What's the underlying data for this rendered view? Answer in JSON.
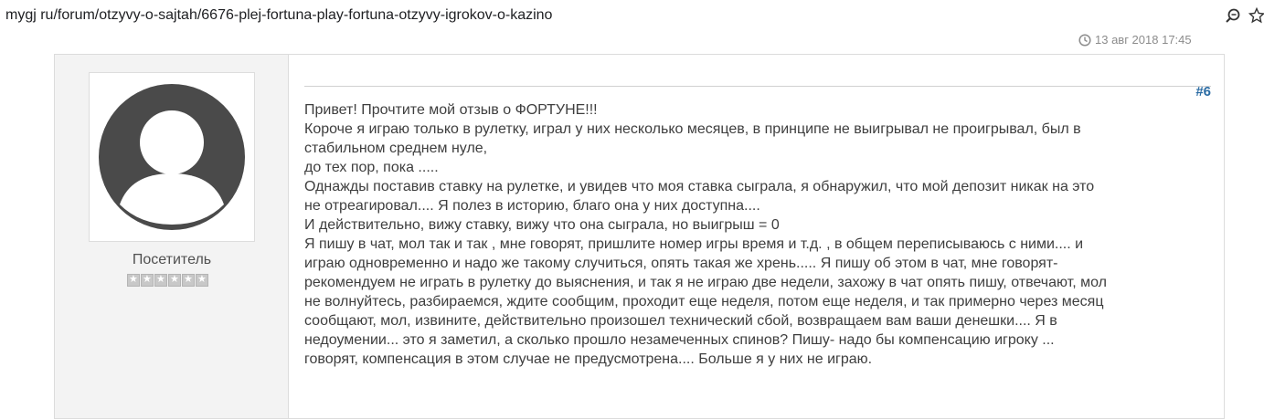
{
  "browser": {
    "url": "mygj ru/forum/otzyvy-o-sajtah/6676-plej-fortuna-play-fortuna-otzyvy-igrokov-o-kazino",
    "icons": [
      "zoom-icon",
      "bookmark-star-icon"
    ]
  },
  "post": {
    "date": "13 авг 2018 17:45",
    "number": "#6",
    "author": {
      "name": "Посетитель",
      "rating_stars": 0,
      "rating_max": 6
    },
    "lines": [
      "Привет! Прочтите мой отзыв о ФОРТУНЕ!!!",
      "Короче я играю только в рулетку, играл у них несколько месяцев, в принципе не выигрывал не проигрывал, был в",
      "стабильном среднем нуле,",
      "до тех пор, пока .....",
      "Однажды поставив ставку на рулетке, и увидев что моя ставка сыграла, я обнаружил, что мой депозит никак на это",
      "не отреагировал.... Я полез в историю, благо она у них доступна....",
      "И действительно, вижу ставку, вижу что она сыграла, но выигрыш = 0",
      "Я пишу в чат, мол так и так , мне говорят, пришлите номер игры время и т.д. , в общем переписываюсь с ними.... и",
      "играю одновременно и надо же такому случиться, опять такая же хрень..... Я пишу об этом в чат, мне говорят-",
      "рекомендуем не играть в рулетку до выяснения, и так я не играю две недели, захожу в чат опять пишу, отвечают, мол",
      "не волнуйтесь, разбираемся, ждите сообщим, проходит еще неделя, потом еще неделя, и так примерно через месяц",
      "сообщают, мол, извините, действительно произошел технический сбой, возвращаем вам ваши денешки.... Я в",
      "недоумении... это я заметил, а сколько прошло незамеченных спинов? Пишу- надо бы компенсацию игроку ...",
      "говорят, компенсация в этом случае не предусмотрена.... Больше я у них не играю."
    ]
  },
  "colors": {
    "post_number": "#2a6ba3",
    "avatar": "#4a4a4a",
    "panel_bg": "#f3f3f3"
  }
}
